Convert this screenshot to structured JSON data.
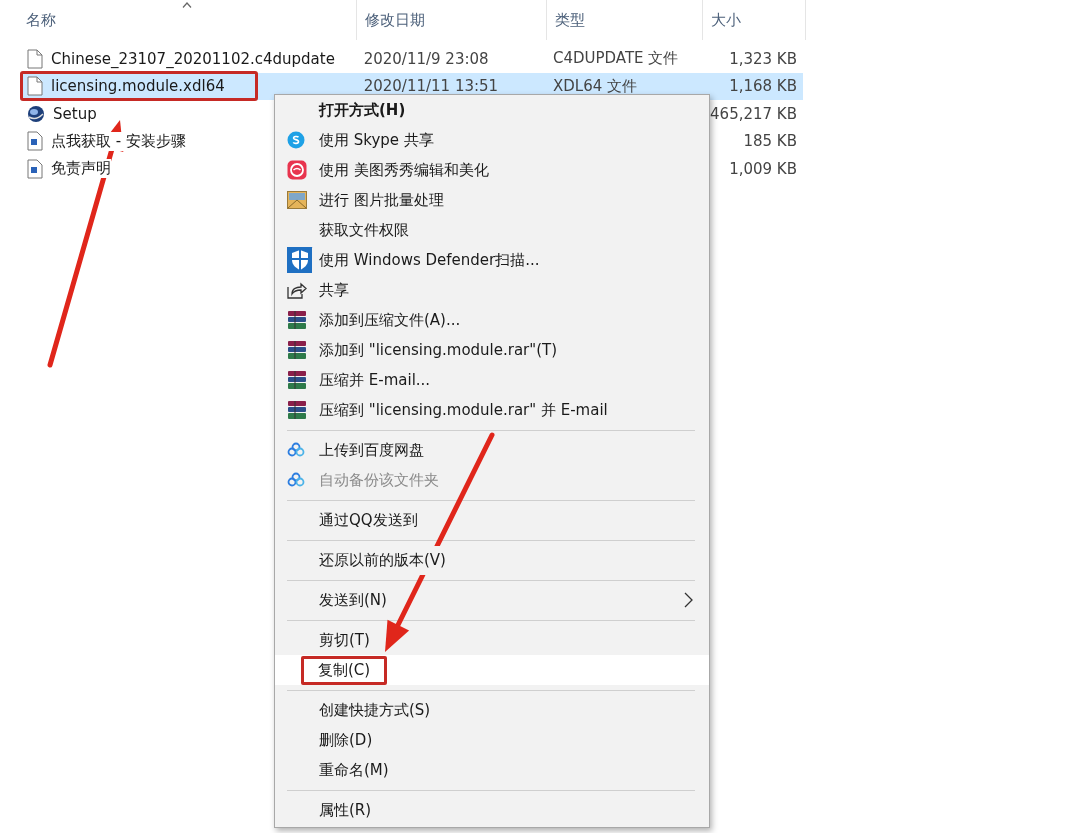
{
  "columns": [
    {
      "label": "名称",
      "sorted": true
    },
    {
      "label": "修改日期",
      "sorted": false
    },
    {
      "label": "类型",
      "sorted": false
    },
    {
      "label": "大小",
      "sorted": false
    }
  ],
  "files": [
    {
      "kind": "file",
      "name": "Chinese_23107_20201102.c4dupdate",
      "date": "2020/11/9 23:08",
      "type": "C4DUPDATE 文件",
      "size": "1,323 KB",
      "selected": false,
      "marked": false
    },
    {
      "kind": "file",
      "name": "licensing.module.xdl64",
      "date": "2020/11/11 13:51",
      "type": "XDL64 文件",
      "size": "1,168 KB",
      "selected": true,
      "marked": true
    },
    {
      "kind": "setup",
      "name": "Setup",
      "size": "465,217 KB",
      "selected": false,
      "marked": false
    },
    {
      "kind": "doc",
      "name": "点我获取 - 安装步骤",
      "size": "185 KB",
      "selected": false,
      "marked": false
    },
    {
      "kind": "doc",
      "name": "免责声明",
      "size": "1,009 KB",
      "selected": false,
      "marked": false
    }
  ],
  "menu": {
    "items": [
      {
        "kind": "default",
        "label": "打开方式(H)",
        "disabled": false,
        "selected": false,
        "submenu": false,
        "marked": false
      },
      {
        "kind": "skype",
        "label": "使用 Skype 共享",
        "disabled": false,
        "selected": false,
        "submenu": false,
        "marked": false
      },
      {
        "kind": "meitu",
        "label": "使用 美图秀秀编辑和美化",
        "disabled": false,
        "selected": false,
        "submenu": false,
        "marked": false
      },
      {
        "kind": "image",
        "label": "进行 图片批量处理",
        "disabled": false,
        "selected": false,
        "submenu": false,
        "marked": false
      },
      {
        "kind": "plain",
        "label": "获取文件权限",
        "disabled": false,
        "selected": false,
        "submenu": false,
        "marked": false
      },
      {
        "kind": "defender",
        "label": "使用 Windows Defender扫描...",
        "disabled": false,
        "selected": false,
        "submenu": false,
        "marked": false
      },
      {
        "kind": "share",
        "label": "共享",
        "disabled": false,
        "selected": false,
        "submenu": false,
        "marked": false
      },
      {
        "kind": "rar",
        "label": "添加到压缩文件(A)...",
        "disabled": false,
        "selected": false,
        "submenu": false,
        "marked": false
      },
      {
        "kind": "rar",
        "label": "添加到 \"licensing.module.rar\"(T)",
        "disabled": false,
        "selected": false,
        "submenu": false,
        "marked": false
      },
      {
        "kind": "rar",
        "label": "压缩并 E-mail...",
        "disabled": false,
        "selected": false,
        "submenu": false,
        "marked": false
      },
      {
        "kind": "rar",
        "label": "压缩到 \"licensing.module.rar\" 并 E-mail",
        "disabled": false,
        "selected": false,
        "submenu": false,
        "marked": false
      },
      {
        "kind": "separator"
      },
      {
        "kind": "baidu",
        "label": "上传到百度网盘",
        "disabled": false,
        "selected": false,
        "submenu": false,
        "marked": false
      },
      {
        "kind": "baidu",
        "label": "自动备份该文件夹",
        "disabled": true,
        "selected": false,
        "submenu": false,
        "marked": false
      },
      {
        "kind": "separator"
      },
      {
        "kind": "plain",
        "label": "通过QQ发送到",
        "disabled": false,
        "selected": false,
        "submenu": false,
        "marked": false
      },
      {
        "kind": "separator"
      },
      {
        "kind": "plain",
        "label": "还原以前的版本(V)",
        "disabled": false,
        "selected": false,
        "submenu": false,
        "marked": false
      },
      {
        "kind": "separator"
      },
      {
        "kind": "plain",
        "label": "发送到(N)",
        "disabled": false,
        "selected": false,
        "submenu": true,
        "marked": false
      },
      {
        "kind": "separator"
      },
      {
        "kind": "plain",
        "label": "剪切(T)",
        "disabled": false,
        "selected": false,
        "submenu": false,
        "marked": false
      },
      {
        "kind": "plain",
        "label": "复制(C)",
        "disabled": false,
        "selected": true,
        "submenu": false,
        "marked": true
      },
      {
        "kind": "separator"
      },
      {
        "kind": "plain",
        "label": "创建快捷方式(S)",
        "disabled": false,
        "selected": false,
        "submenu": false,
        "marked": false
      },
      {
        "kind": "plain",
        "label": "删除(D)",
        "disabled": false,
        "selected": false,
        "submenu": false,
        "marked": false
      },
      {
        "kind": "plain",
        "label": "重命名(M)",
        "disabled": false,
        "selected": false,
        "submenu": false,
        "marked": false
      },
      {
        "kind": "separator"
      },
      {
        "kind": "plain",
        "label": "属性(R)",
        "disabled": false,
        "selected": false,
        "submenu": false,
        "marked": false
      }
    ]
  }
}
